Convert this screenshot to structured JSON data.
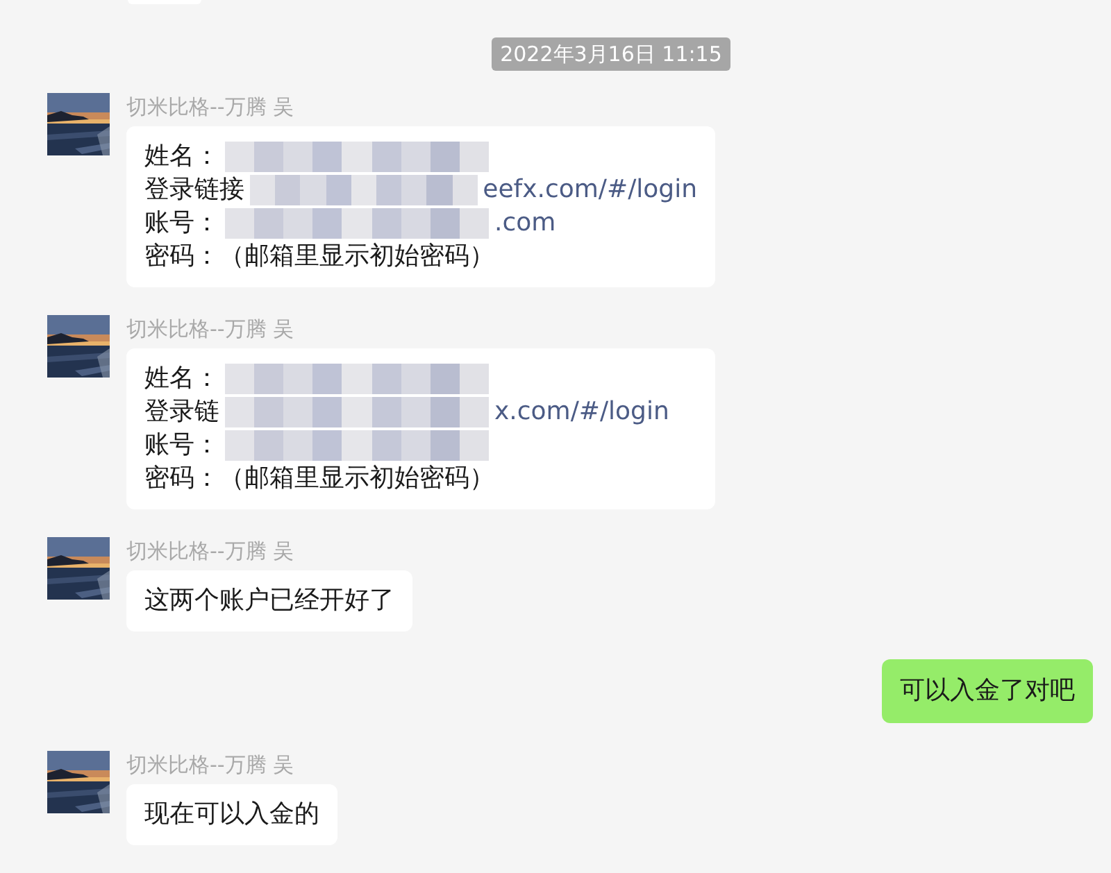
{
  "timestamp": "2022年3月16日 11:15",
  "messages": [
    {
      "kind": "received",
      "sender": "切米比格--万腾 吴",
      "lines": [
        {
          "text": "姓名：",
          "redacted": true
        },
        {
          "text": "登录链接",
          "redacted": true,
          "tail": "eefx.com/#/login"
        },
        {
          "text": "账号：",
          "redacted": true,
          "tail": ".com"
        },
        {
          "text": "密码：（邮箱里显示初始密码）",
          "redacted": false
        }
      ]
    },
    {
      "kind": "received",
      "sender": "切米比格--万腾 吴",
      "lines": [
        {
          "text": "姓名：",
          "redacted": true
        },
        {
          "text": "登录链",
          "redacted": true,
          "tail": "x.com/#/login"
        },
        {
          "text": "账号：",
          "redacted": true
        },
        {
          "text": "密码：（邮箱里显示初始密码）",
          "redacted": false
        }
      ]
    },
    {
      "kind": "received",
      "sender": "切米比格--万腾 吴",
      "text": "这两个账户已经开好了"
    },
    {
      "kind": "sent",
      "text": "可以入金了对吧"
    },
    {
      "kind": "received",
      "sender": "切米比格--万腾 吴",
      "text": "现在可以入金的"
    }
  ]
}
